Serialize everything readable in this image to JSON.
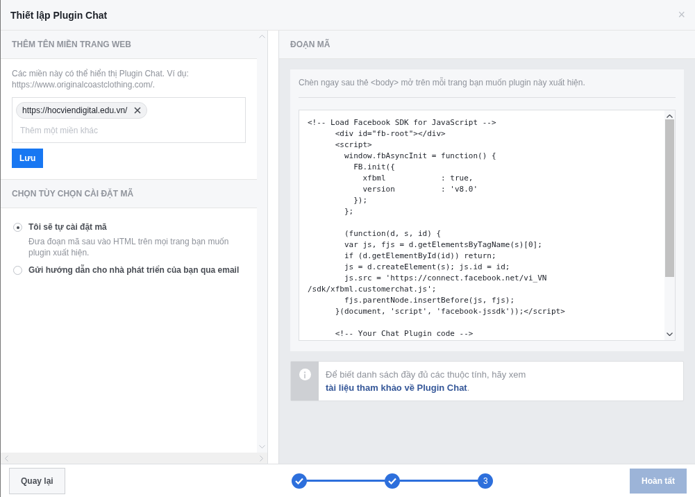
{
  "window": {
    "title": "Thiết lập Plugin Chat",
    "close": "×"
  },
  "domains_section": {
    "heading": "THÊM TÊN MIỀN TRANG WEB",
    "description": "Các miền này có thể hiển thị Plugin Chat. Ví dụ: https://www.originalcoastclothing.com/.",
    "tags": [
      {
        "label": "https://hocviendigital.edu.vn/"
      }
    ],
    "placeholder": "Thêm một miền khác",
    "save_button": "Lưu"
  },
  "install_section": {
    "heading": "CHỌN TÙY CHỌN CÀI ĐẶT MÃ",
    "options": [
      {
        "label": "Tôi sẽ tự cài đặt mã",
        "description": "Đưa đoạn mã sau vào HTML trên mọi trang bạn muốn plugin xuất hiện.",
        "selected": true
      },
      {
        "label": "Gửi hướng dẫn cho nhà phát triển của bạn qua email",
        "selected": false
      }
    ]
  },
  "code_section": {
    "heading": "ĐOẠN MÃ",
    "instruction": "Chèn ngay sau thẻ <body> mở trên mỗi trang bạn muốn plugin này xuất hiện.",
    "code": "<!-- Load Facebook SDK for JavaScript -->\n      <div id=\"fb-root\"></div>\n      <script>\n        window.fbAsyncInit = function() {\n          FB.init({\n            xfbml            : true,\n            version          : 'v8.0'\n          });\n        };\n\n        (function(d, s, id) {\n        var js, fjs = d.getElementsByTagName(s)[0];\n        if (d.getElementById(id)) return;\n        js = d.createElement(s); js.id = id;\n        js.src = 'https://connect.facebook.net/vi_VN\n/sdk/xfbml.customerchat.js';\n        fjs.parentNode.insertBefore(js, fjs);\n      }(document, 'script', 'facebook-jssdk'));</script>\n\n      <!-- Your Chat Plugin code -->",
    "info_text": "Để biết danh sách đầy đủ các thuộc tính, hãy xem ",
    "info_link": "tài liệu tham khảo về Plugin Chat",
    "info_end": "."
  },
  "footer": {
    "back_button": "Quay lại",
    "steps": [
      {
        "completed": true
      },
      {
        "completed": true
      },
      {
        "completed": false,
        "label": "3"
      }
    ],
    "finish_button": {
      "label": "Hoàn tất",
      "disabled": true
    }
  }
}
